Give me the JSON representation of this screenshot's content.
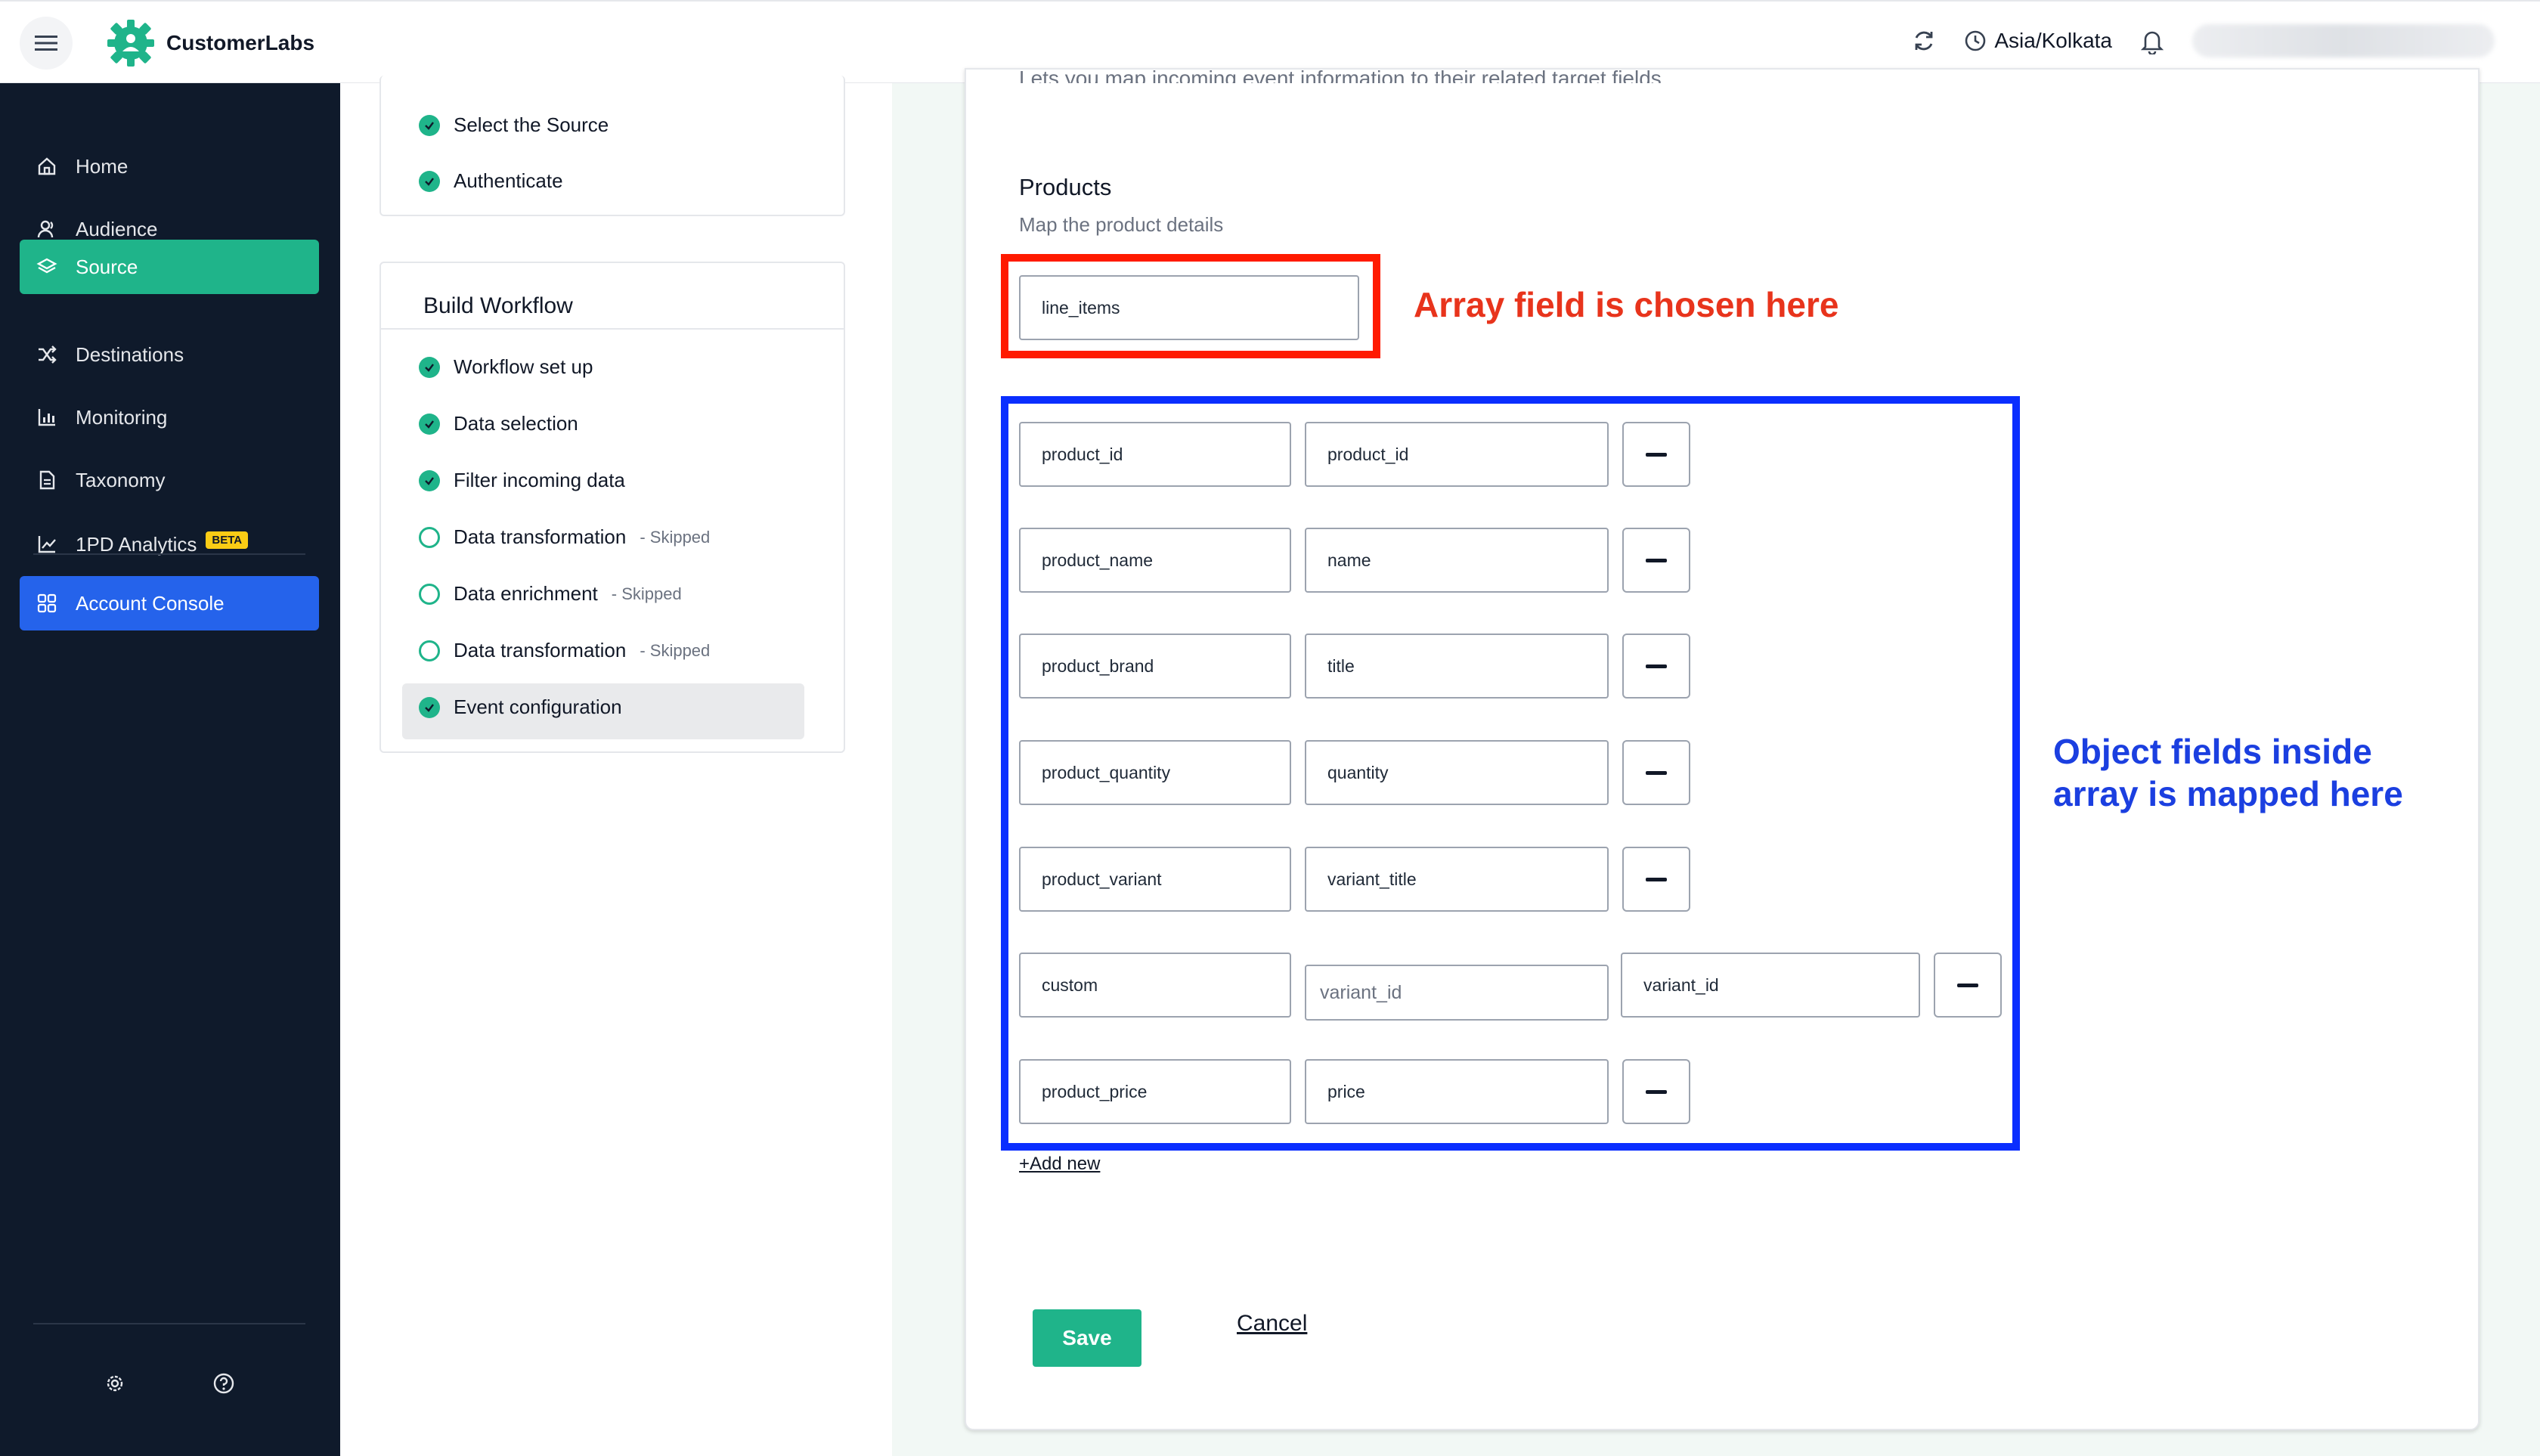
{
  "app": {
    "name": "CustomerLabs",
    "timezone": "Asia/Kolkata"
  },
  "sidebar": {
    "items": [
      {
        "label": "Home",
        "icon": "home-icon"
      },
      {
        "label": "Audience",
        "icon": "audience-icon"
      },
      {
        "label": "Source",
        "icon": "layers-icon",
        "active": true
      },
      {
        "label": "Destinations",
        "icon": "shuffle-icon"
      },
      {
        "label": "Monitoring",
        "icon": "chart-icon"
      },
      {
        "label": "Taxonomy",
        "icon": "document-icon"
      },
      {
        "label": "1PD Analytics",
        "icon": "trend-icon",
        "badge": "BETA"
      }
    ],
    "console_label": "Account Console"
  },
  "setup_card": {
    "steps": [
      "Select the Source",
      "Authenticate"
    ]
  },
  "workflow_card": {
    "title": "Build Workflow",
    "steps": [
      {
        "label": "Workflow set up",
        "done": true,
        "note": ""
      },
      {
        "label": "Data selection",
        "done": true,
        "note": ""
      },
      {
        "label": "Filter incoming data",
        "done": true,
        "note": ""
      },
      {
        "label": "Data transformation",
        "done": false,
        "note": "- Skipped"
      },
      {
        "label": "Data enrichment",
        "done": false,
        "note": "- Skipped"
      },
      {
        "label": "Data transformation",
        "done": false,
        "note": "- Skipped"
      },
      {
        "label": "Event configuration",
        "done": true,
        "note": "",
        "active": true
      }
    ]
  },
  "main": {
    "cut_text": "Lets you map incoming event information to their related target fields",
    "products_title": "Products",
    "products_subtitle": "Map the product details",
    "array_field_value": "line_items",
    "array_note": "Array field is chosen here",
    "object_note": "Object fields inside array is mapped here",
    "mappings": [
      {
        "source": "product_id",
        "target": "product_id"
      },
      {
        "source": "product_name",
        "target": "name"
      },
      {
        "source": "product_brand",
        "target": "title"
      },
      {
        "source": "product_quantity",
        "target": "quantity"
      },
      {
        "source": "product_variant",
        "target": "variant_title"
      },
      {
        "source": "custom",
        "target_placeholder": "variant_id",
        "custom_value": "variant_id"
      },
      {
        "source": "product_price",
        "target": "price"
      }
    ],
    "add_new_label": "+Add new",
    "save_label": "Save",
    "cancel_label": "Cancel"
  },
  "colors": {
    "sidebar_bg": "#0f1a2b",
    "accent_green": "#1fb48a",
    "console_blue": "#2563eb",
    "annotation_red": "#ff1a00",
    "annotation_blue": "#0a2eff"
  }
}
